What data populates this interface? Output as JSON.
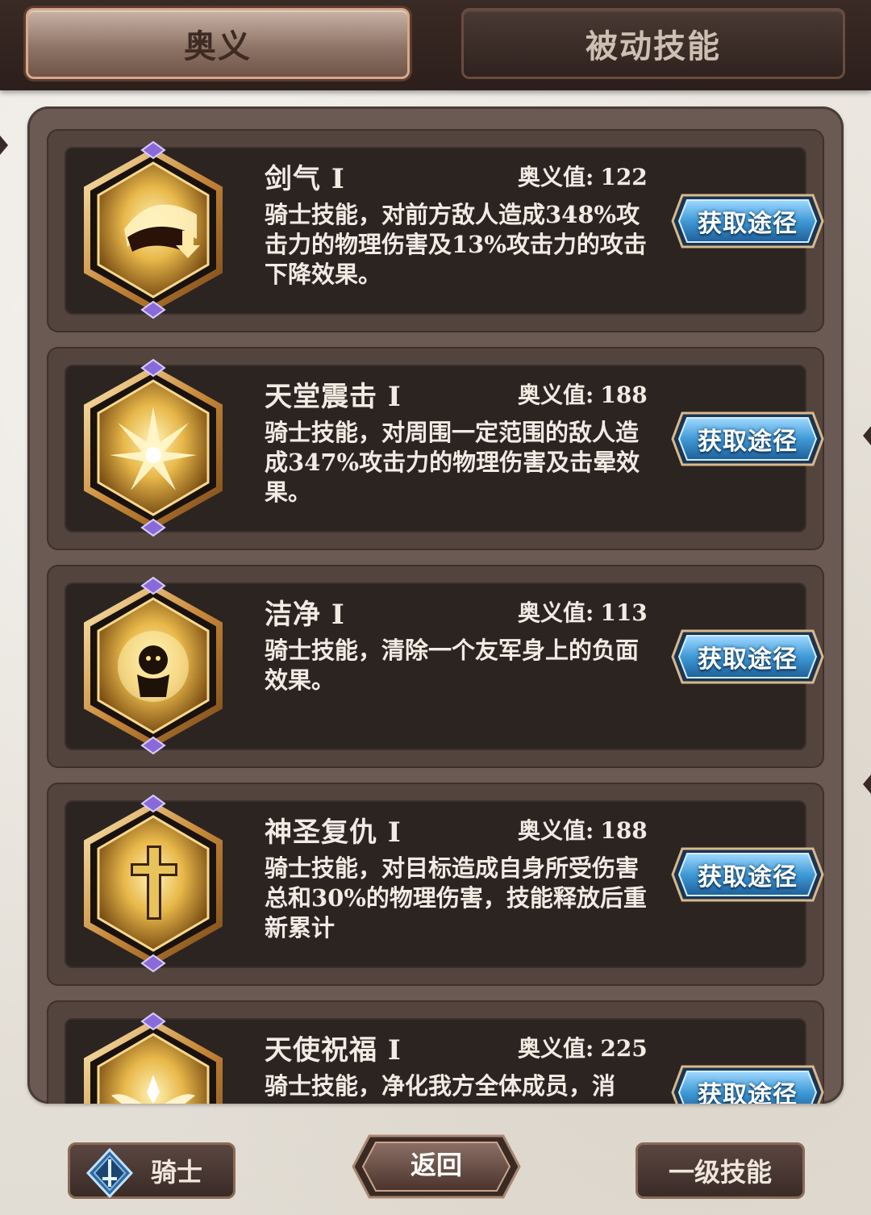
{
  "tabs": [
    {
      "label": "奥义",
      "active": true
    },
    {
      "label": "被动技能",
      "active": false
    }
  ],
  "value_prefix": "奥义值:",
  "get_button_label": "获取途径",
  "skills": [
    {
      "name": "剑气 Ⅰ",
      "value": "122",
      "description": "骑士技能，对前方敌人造成348%攻击力的物理伤害及13%攻击力的攻击下降效果。",
      "icon": "sword-aura-icon"
    },
    {
      "name": "天堂震击 Ⅰ",
      "value": "188",
      "description": "骑士技能，对周围一定范围的敌人造成347%攻击力的物理伤害及击晕效果。",
      "icon": "heaven-strike-icon"
    },
    {
      "name": "洁净 Ⅰ",
      "value": "113",
      "description": "骑士技能，清除一个友军身上的负面效果。",
      "icon": "purify-icon"
    },
    {
      "name": "神圣复仇 Ⅰ",
      "value": "188",
      "description": "骑士技能，对目标造成自身所受伤害总和30%的物理伤害，技能释放后重新累计",
      "icon": "holy-cross-icon"
    },
    {
      "name": "天使祝福 Ⅰ",
      "value": "225",
      "description": "骑士技能，净化我方全体成员，消",
      "icon": "angel-wings-icon"
    }
  ],
  "bottom": {
    "class_label": "骑士",
    "back_label": "返回",
    "level_label": "一级技能"
  },
  "colors": {
    "top_bar": "#2c1f1b",
    "panel": "#6a5a53",
    "card_inner": "#2c2421",
    "button_blue": "#3f9ad6",
    "icon_gold": "#e8b84a",
    "gem_purple": "#8a6ad8"
  }
}
